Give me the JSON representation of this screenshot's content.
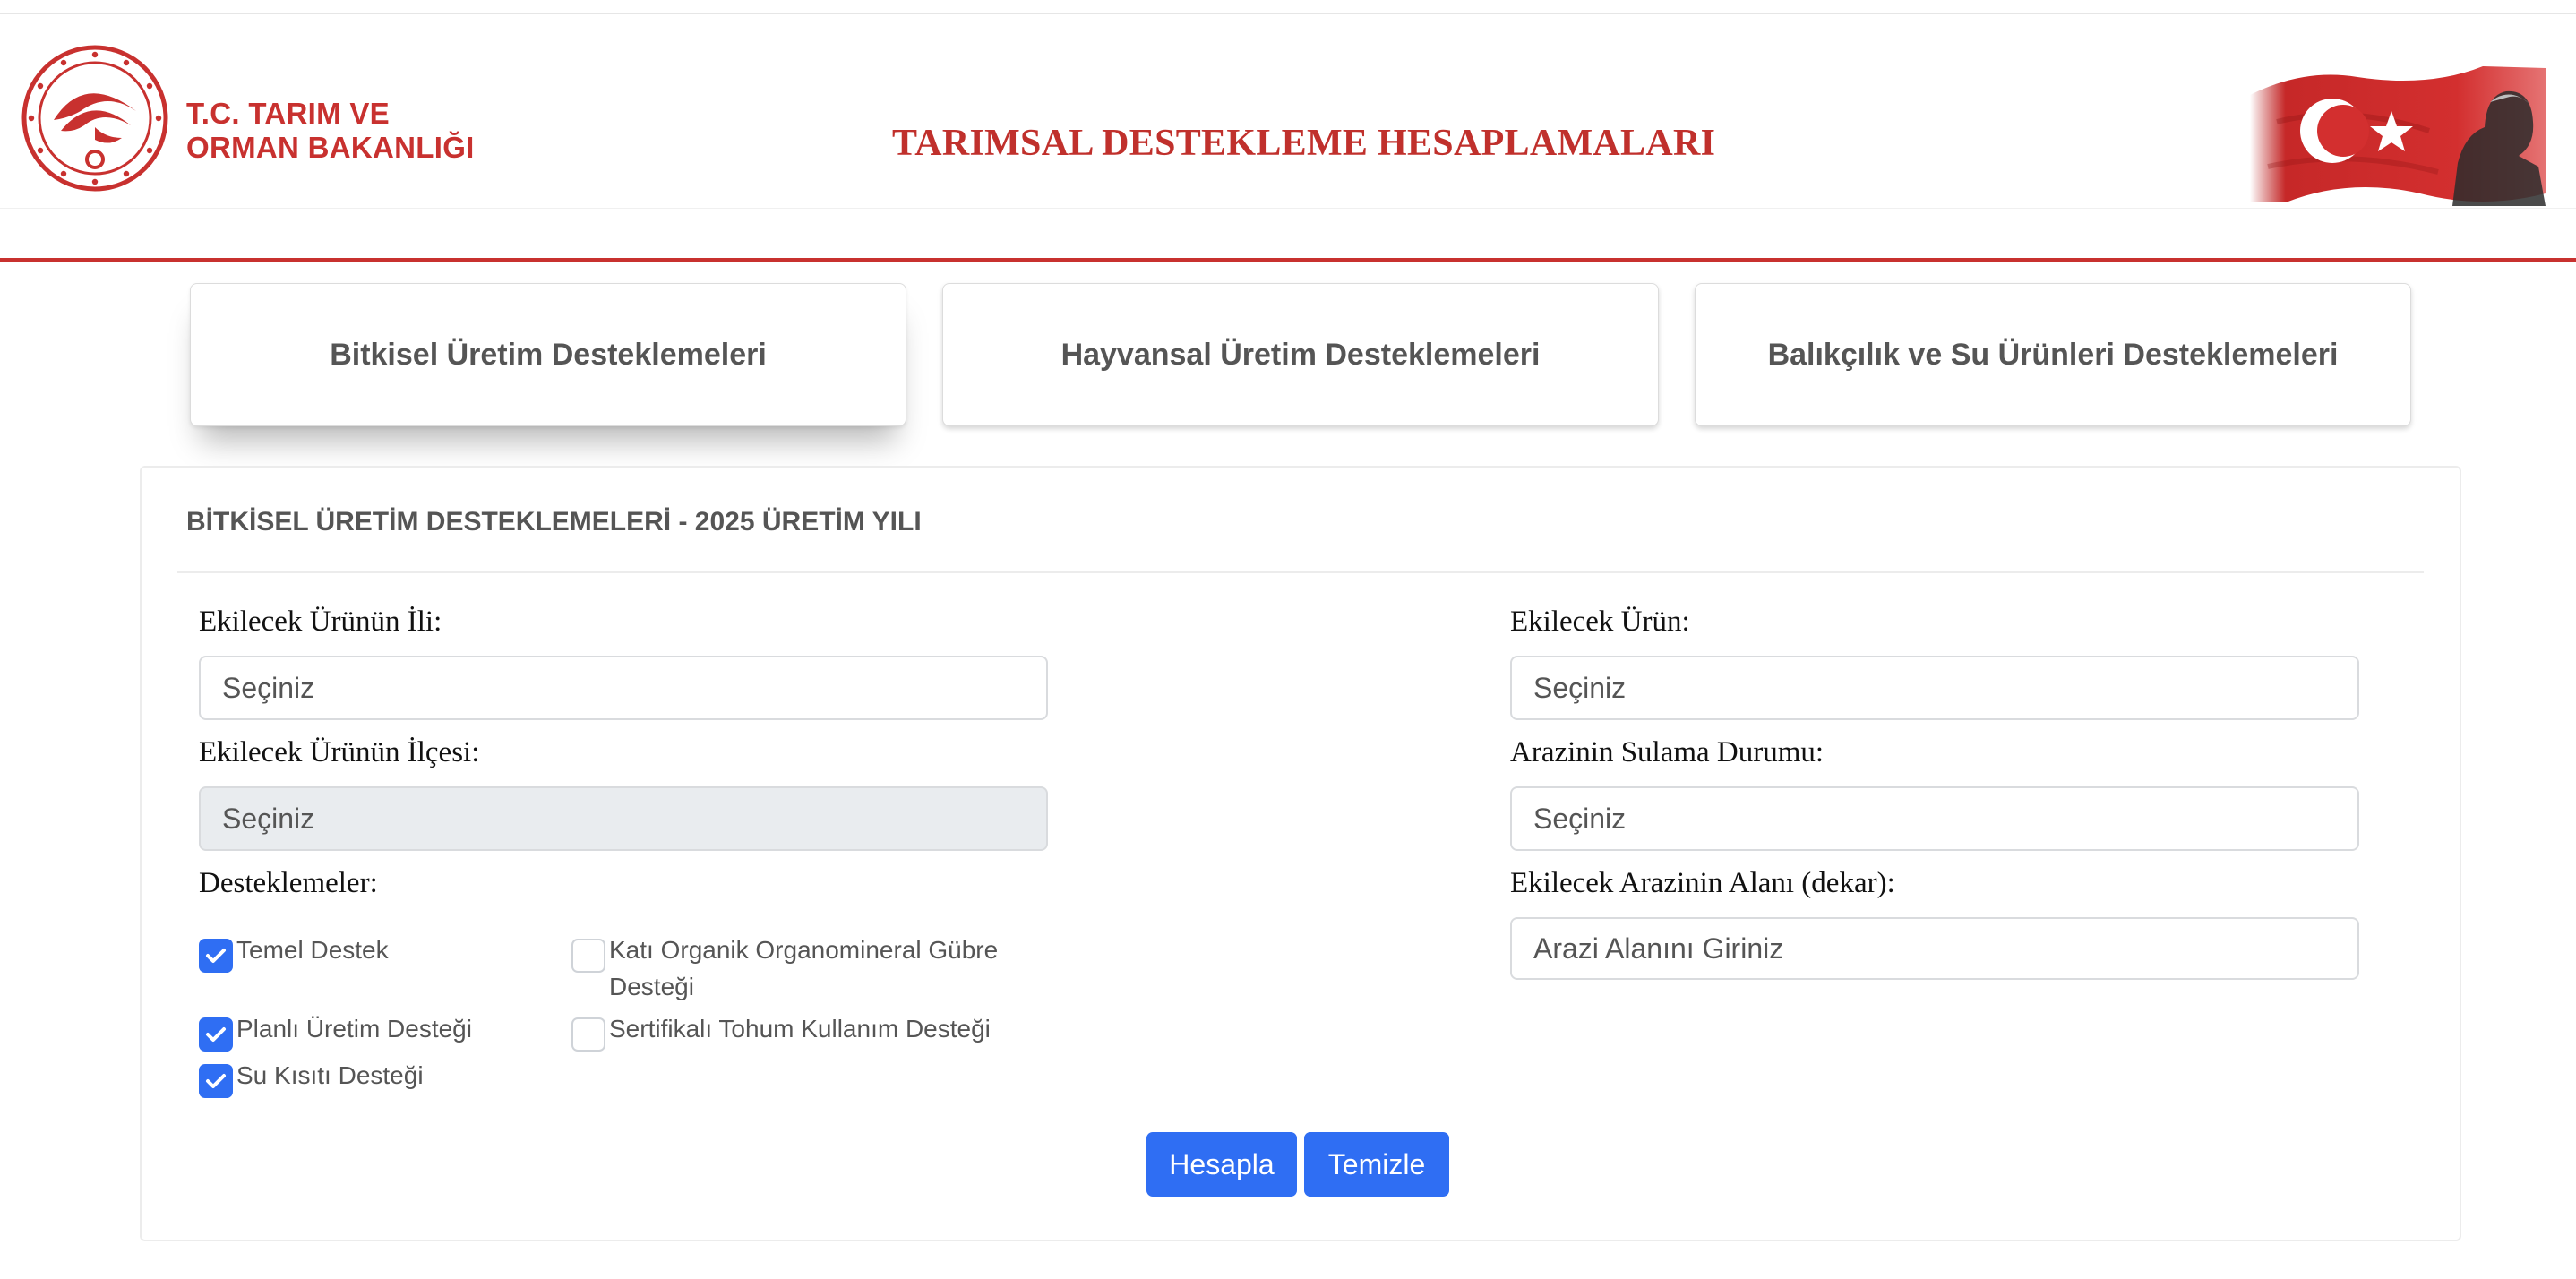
{
  "header": {
    "org_line1": "T.C. TARIM VE",
    "org_line2": "ORMAN BAKANLIĞI",
    "title": "TARIMSAL DESTEKLEME HESAPLAMALARI"
  },
  "tabs": [
    {
      "label": "Bitkisel Üretim Desteklemeleri",
      "active": true
    },
    {
      "label": "Hayvansal Üretim Desteklemeleri",
      "active": false
    },
    {
      "label": "Balıkçılık ve Su Ürünleri Desteklemeleri",
      "active": false
    }
  ],
  "form": {
    "title": "BİTKİSEL ÜRETİM DESTEKLEMELERİ - 2025 ÜRETİM YILI",
    "il_label": "Ekilecek Ürünün İli:",
    "il_value": "Seçiniz",
    "ilce_label": "Ekilecek Ürünün İlçesi:",
    "ilce_value": "Seçiniz",
    "urun_label": "Ekilecek Ürün:",
    "urun_value": "Seçiniz",
    "sulama_label": "Arazinin Sulama Durumu:",
    "sulama_value": "Seçiniz",
    "alan_label": "Ekilecek Arazinin Alanı (dekar):",
    "alan_placeholder": "Arazi Alanını Giriniz",
    "destek_label": "Desteklemeler:",
    "checkboxes": [
      {
        "label": "Temel Destek",
        "checked": true
      },
      {
        "label": "Katı Organik Organomineral Gübre Desteği",
        "checked": false
      },
      {
        "label": "Planlı Üretim Desteği",
        "checked": true
      },
      {
        "label": "Sertifikalı Tohum Kullanım Desteği",
        "checked": false
      },
      {
        "label": "Su Kısıtı Desteği",
        "checked": true
      }
    ],
    "calc_button": "Hesapla",
    "clear_button": "Temizle"
  },
  "colors": {
    "brand_red": "#c8312f",
    "primary_blue": "#2f6ef3"
  }
}
